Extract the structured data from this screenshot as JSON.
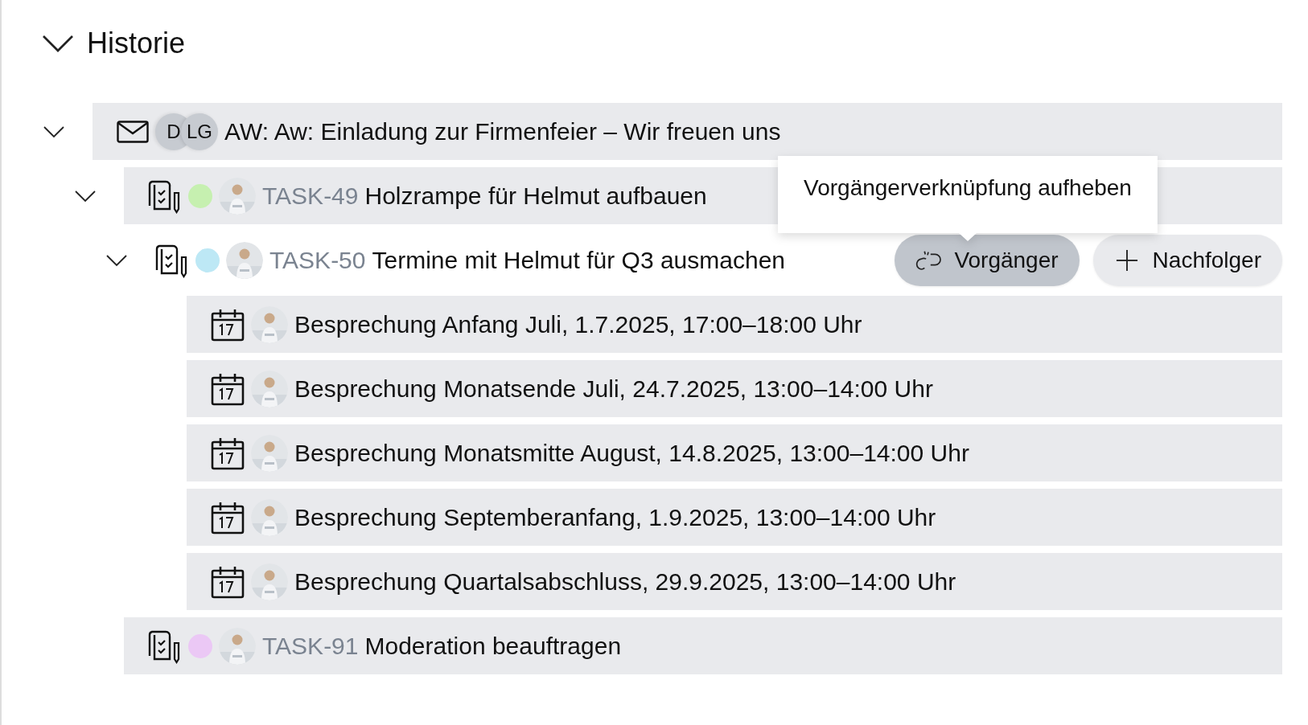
{
  "section": {
    "title": "Historie",
    "expanded": true
  },
  "tree": [
    {
      "kind": "mail",
      "expanded": true,
      "hovered": false,
      "avatars": [
        {
          "kind": "initials",
          "text": "D"
        },
        {
          "kind": "initials",
          "text": "LG"
        }
      ],
      "title": "AW: Aw: Einladung zur Firmenfeier – Wir freuen uns",
      "children": [
        {
          "kind": "task",
          "expanded": true,
          "hovered": false,
          "color": "#c6f0b0",
          "avatars": [
            {
              "kind": "picture"
            }
          ],
          "key": "TASK-49",
          "title": "Holzrampe für Helmut aufbauen",
          "children": [
            {
              "kind": "task",
              "expanded": true,
              "hovered": true,
              "color": "#bde8f5",
              "avatars": [
                {
                  "kind": "picture"
                }
              ],
              "key": "TASK-50",
              "title": "Termine mit Helmut für Q3 ausmachen",
              "actions": [
                {
                  "kind": "unlink",
                  "label": "Vorgänger",
                  "highlighted": true,
                  "tooltip": "Vorgängerverknüpfung aufheben"
                },
                {
                  "kind": "add",
                  "label": "Nachfolger",
                  "highlighted": false
                }
              ],
              "children": [
                {
                  "kind": "event",
                  "hovered": false,
                  "avatars": [
                    {
                      "kind": "picture"
                    }
                  ],
                  "title": "Besprechung Anfang Juli, 1.7.2025, 17:00–18:00 Uhr"
                },
                {
                  "kind": "event",
                  "hovered": false,
                  "avatars": [
                    {
                      "kind": "picture"
                    }
                  ],
                  "title": "Besprechung Monatsende Juli, 24.7.2025, 13:00–14:00 Uhr"
                },
                {
                  "kind": "event",
                  "hovered": false,
                  "avatars": [
                    {
                      "kind": "picture"
                    }
                  ],
                  "title": "Besprechung Monatsmitte August, 14.8.2025, 13:00–14:00 Uhr"
                },
                {
                  "kind": "event",
                  "hovered": false,
                  "avatars": [
                    {
                      "kind": "picture"
                    }
                  ],
                  "title": "Besprechung Septemberanfang, 1.9.2025, 13:00–14:00 Uhr"
                },
                {
                  "kind": "event",
                  "hovered": false,
                  "avatars": [
                    {
                      "kind": "picture"
                    }
                  ],
                  "title": "Besprechung Quartalsabschluss, 29.9.2025, 13:00–14:00 Uhr"
                }
              ]
            }
          ]
        },
        {
          "kind": "task",
          "hovered": false,
          "color": "#ebc8f5",
          "avatars": [
            {
              "kind": "picture"
            }
          ],
          "key": "TASK-91",
          "title": "Moderation beauftragen"
        }
      ]
    }
  ]
}
